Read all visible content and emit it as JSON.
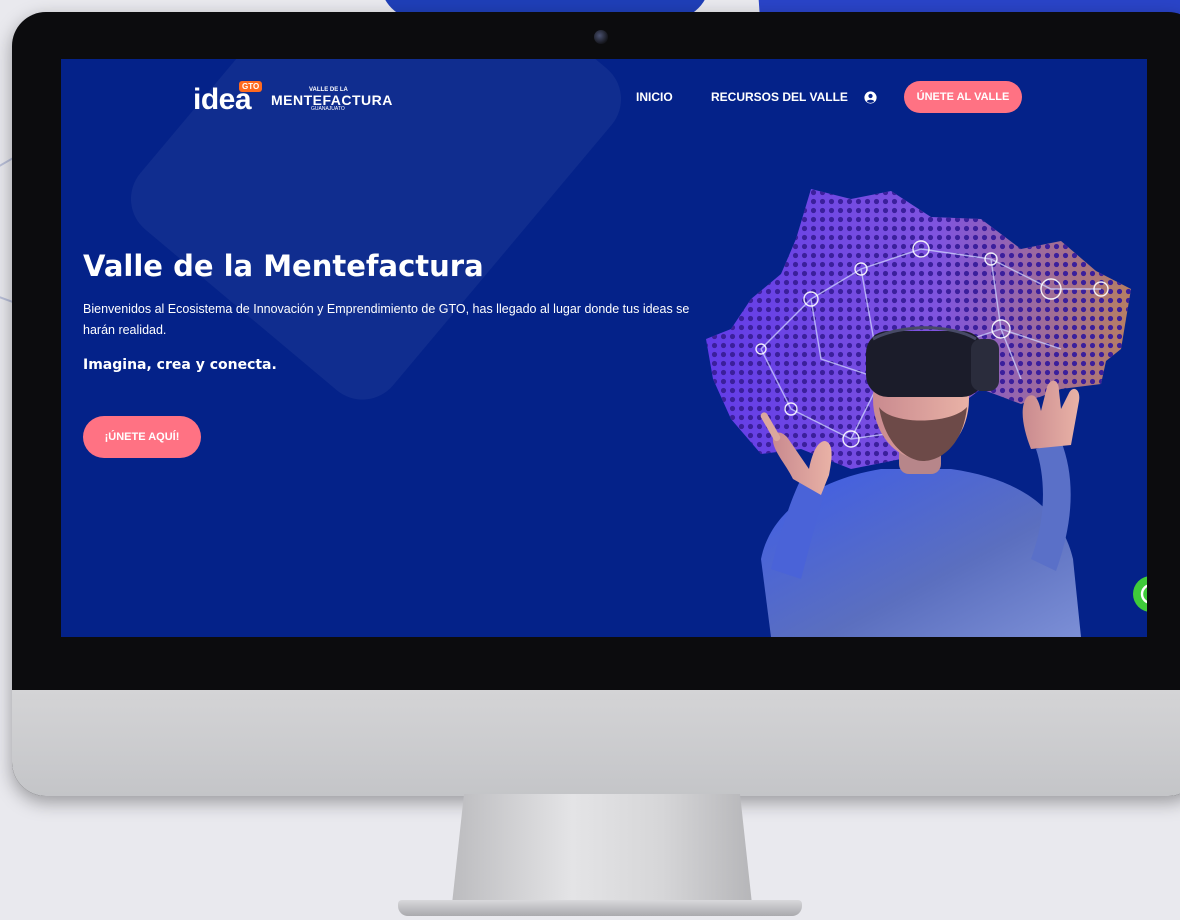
{
  "nav": {
    "logo_idea": "idea",
    "logo_gto": "GTO",
    "logo_valle_small": "VALLE DE LA",
    "logo_valle_big": "MENTEFACTURA",
    "logo_valle_tiny": "GUANAJUATO",
    "links": [
      "INICIO",
      "RECURSOS DEL VALLE"
    ],
    "cta": "ÚNETE AL VALLE"
  },
  "hero": {
    "title": "Valle de la Mentefactura",
    "description": "Bienvenidos al Ecosistema de Innovación y Emprendimiento de GTO, has llegado al lugar donde tus ideas se harán realidad.",
    "tagline": "Imagina, crea y conecta.",
    "cta": "¡ÚNETE AQUÍ!"
  },
  "colors": {
    "screen_bg": "#042289",
    "accent_pink": "#ff7283",
    "logo_orange": "#ff6a1f",
    "whatsapp_green": "#3fcb3a"
  },
  "icons": [
    "user-icon",
    "whatsapp-icon",
    "gto-arrow-icon"
  ]
}
